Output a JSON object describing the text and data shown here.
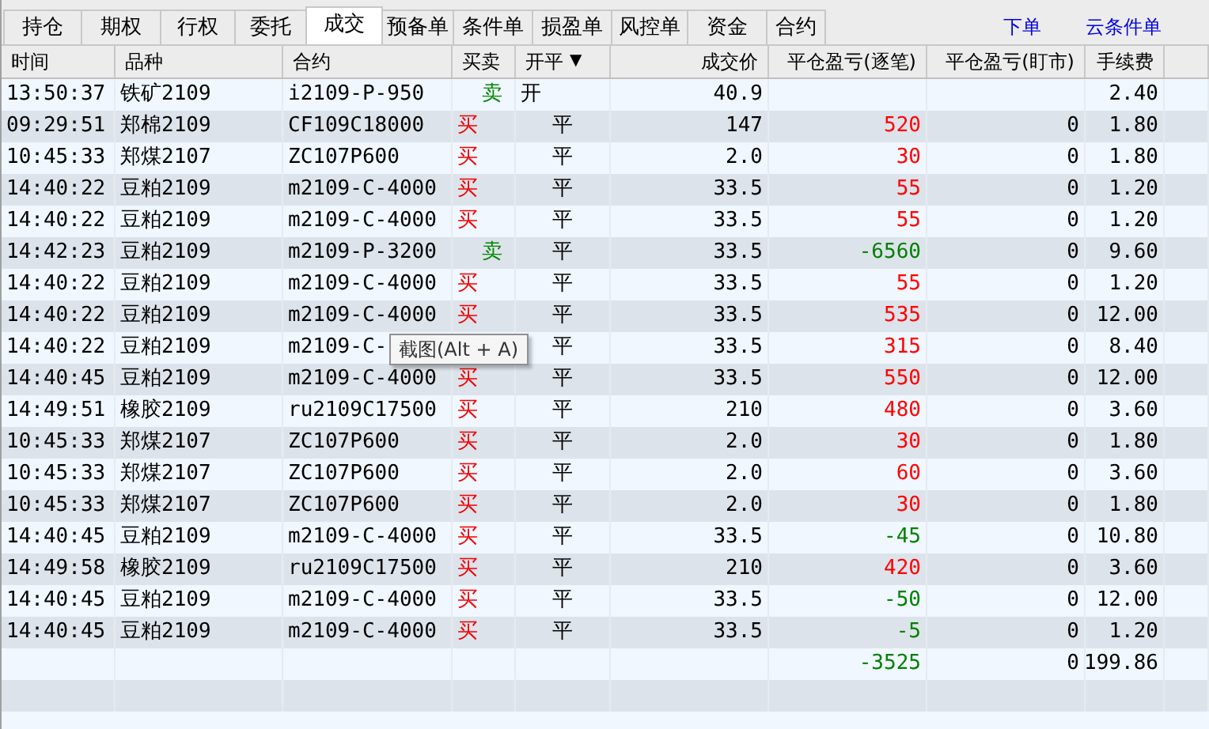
{
  "tabs": [
    {
      "label": "持仓",
      "selected": false
    },
    {
      "label": "期权",
      "selected": false
    },
    {
      "label": "行权",
      "selected": false
    },
    {
      "label": "委托",
      "selected": false
    },
    {
      "label": "成交",
      "selected": true
    },
    {
      "label": "预备单",
      "selected": false
    },
    {
      "label": "条件单",
      "selected": false
    },
    {
      "label": "损盈单",
      "selected": false
    },
    {
      "label": "风控单",
      "selected": false
    },
    {
      "label": "资金",
      "selected": false
    },
    {
      "label": "合约",
      "selected": false
    }
  ],
  "links": [
    "下单",
    "云条件单"
  ],
  "table": {
    "columns": [
      {
        "label": "时间"
      },
      {
        "label": "品种"
      },
      {
        "label": "合约"
      },
      {
        "label": "买卖"
      },
      {
        "label": "开平",
        "sort": "▼"
      },
      {
        "label": "成交价"
      },
      {
        "label": "平仓盈亏(逐笔)"
      },
      {
        "label": "平仓盈亏(盯市)"
      },
      {
        "label": "手续费"
      }
    ],
    "rows": [
      {
        "time": "13:50:37",
        "variety": "铁矿2109",
        "contract": "i2109-P-950",
        "side": {
          "text": "卖",
          "kind": "sell"
        },
        "offset": {
          "text": "开",
          "kind": "open"
        },
        "price": "40.9",
        "fee": "2.40"
      },
      {
        "time": "09:29:51",
        "variety": "郑棉2109",
        "contract": "CF109C18000",
        "side": {
          "text": "买",
          "kind": "buy"
        },
        "offset": {
          "text": "平",
          "kind": "close"
        },
        "price": "147",
        "pnl": {
          "text": "520",
          "color": "#ff0000"
        },
        "pnl_mark": "0",
        "fee": "1.80"
      },
      {
        "time": "10:45:33",
        "variety": "郑煤2107",
        "contract": "ZC107P600",
        "side": {
          "text": "买",
          "kind": "buy"
        },
        "offset": {
          "text": "平",
          "kind": "close"
        },
        "price": "2.0",
        "pnl": {
          "text": "30",
          "color": "#ff0000"
        },
        "pnl_mark": "0",
        "fee": "1.80"
      },
      {
        "time": "14:40:22",
        "variety": "豆粕2109",
        "contract": "m2109-C-4000",
        "side": {
          "text": "买",
          "kind": "buy"
        },
        "offset": {
          "text": "平",
          "kind": "close"
        },
        "price": "33.5",
        "pnl": {
          "text": "55",
          "color": "#ff0000"
        },
        "pnl_mark": "0",
        "fee": "1.20"
      },
      {
        "time": "14:40:22",
        "variety": "豆粕2109",
        "contract": "m2109-C-4000",
        "side": {
          "text": "买",
          "kind": "buy"
        },
        "offset": {
          "text": "平",
          "kind": "close"
        },
        "price": "33.5",
        "pnl": {
          "text": "55",
          "color": "#ff0000"
        },
        "pnl_mark": "0",
        "fee": "1.20"
      },
      {
        "time": "14:42:23",
        "variety": "豆粕2109",
        "contract": "m2109-P-3200",
        "side": {
          "text": "卖",
          "kind": "sell"
        },
        "offset": {
          "text": "平",
          "kind": "close"
        },
        "price": "33.5",
        "pnl": {
          "text": "-6560",
          "color": "#008000"
        },
        "pnl_mark": "0",
        "fee": "9.60"
      },
      {
        "time": "14:40:22",
        "variety": "豆粕2109",
        "contract": "m2109-C-4000",
        "side": {
          "text": "买",
          "kind": "buy"
        },
        "offset": {
          "text": "平",
          "kind": "close"
        },
        "price": "33.5",
        "pnl": {
          "text": "55",
          "color": "#ff0000"
        },
        "pnl_mark": "0",
        "fee": "1.20"
      },
      {
        "time": "14:40:22",
        "variety": "豆粕2109",
        "contract": "m2109-C-4000",
        "side": {
          "text": "买",
          "kind": "buy"
        },
        "offset": {
          "text": "平",
          "kind": "close"
        },
        "price": "33.5",
        "pnl": {
          "text": "535",
          "color": "#ff0000"
        },
        "pnl_mark": "0",
        "fee": "12.00"
      },
      {
        "time": "14:40:22",
        "variety": "豆粕2109",
        "contract": "m2109-C-",
        "offset": {
          "text": "平",
          "kind": "close"
        },
        "price": "33.5",
        "pnl": {
          "text": "315",
          "color": "#ff0000"
        },
        "pnl_mark": "0",
        "fee": "8.40"
      },
      {
        "time": "14:40:45",
        "variety": "豆粕2109",
        "contract": "m2109-C-4000",
        "side": {
          "text": "买",
          "kind": "buy"
        },
        "offset": {
          "text": "平",
          "kind": "close"
        },
        "price": "33.5",
        "pnl": {
          "text": "550",
          "color": "#ff0000"
        },
        "pnl_mark": "0",
        "fee": "12.00"
      },
      {
        "time": "14:49:51",
        "variety": "橡胶2109",
        "contract": "ru2109C17500",
        "side": {
          "text": "买",
          "kind": "buy"
        },
        "offset": {
          "text": "平",
          "kind": "close"
        },
        "price": "210",
        "pnl": {
          "text": "480",
          "color": "#ff0000"
        },
        "pnl_mark": "0",
        "fee": "3.60"
      },
      {
        "time": "10:45:33",
        "variety": "郑煤2107",
        "contract": "ZC107P600",
        "side": {
          "text": "买",
          "kind": "buy"
        },
        "offset": {
          "text": "平",
          "kind": "close"
        },
        "price": "2.0",
        "pnl": {
          "text": "30",
          "color": "#ff0000"
        },
        "pnl_mark": "0",
        "fee": "1.80"
      },
      {
        "time": "10:45:33",
        "variety": "郑煤2107",
        "contract": "ZC107P600",
        "side": {
          "text": "买",
          "kind": "buy"
        },
        "offset": {
          "text": "平",
          "kind": "close"
        },
        "price": "2.0",
        "pnl": {
          "text": "60",
          "color": "#ff0000"
        },
        "pnl_mark": "0",
        "fee": "3.60"
      },
      {
        "time": "10:45:33",
        "variety": "郑煤2107",
        "contract": "ZC107P600",
        "side": {
          "text": "买",
          "kind": "buy"
        },
        "offset": {
          "text": "平",
          "kind": "close"
        },
        "price": "2.0",
        "pnl": {
          "text": "30",
          "color": "#ff0000"
        },
        "pnl_mark": "0",
        "fee": "1.80"
      },
      {
        "time": "14:40:45",
        "variety": "豆粕2109",
        "contract": "m2109-C-4000",
        "side": {
          "text": "买",
          "kind": "buy"
        },
        "offset": {
          "text": "平",
          "kind": "close"
        },
        "price": "33.5",
        "pnl": {
          "text": "-45",
          "color": "#008000"
        },
        "pnl_mark": "0",
        "fee": "10.80"
      },
      {
        "time": "14:49:58",
        "variety": "橡胶2109",
        "contract": "ru2109C17500",
        "side": {
          "text": "买",
          "kind": "buy"
        },
        "offset": {
          "text": "平",
          "kind": "close"
        },
        "price": "210",
        "pnl": {
          "text": "420",
          "color": "#ff0000"
        },
        "pnl_mark": "0",
        "fee": "3.60"
      },
      {
        "time": "14:40:45",
        "variety": "豆粕2109",
        "contract": "m2109-C-4000",
        "side": {
          "text": "买",
          "kind": "buy"
        },
        "offset": {
          "text": "平",
          "kind": "close"
        },
        "price": "33.5",
        "pnl": {
          "text": "-50",
          "color": "#008000"
        },
        "pnl_mark": "0",
        "fee": "12.00"
      },
      {
        "time": "14:40:45",
        "variety": "豆粕2109",
        "contract": "m2109-C-4000",
        "side": {
          "text": "买",
          "kind": "buy"
        },
        "offset": {
          "text": "平",
          "kind": "close"
        },
        "price": "33.5",
        "pnl": {
          "text": "-5",
          "color": "#008000"
        },
        "pnl_mark": "0",
        "fee": "1.20"
      }
    ],
    "totals": {
      "pnl": {
        "text": "-3525",
        "color": "#008000"
      },
      "pnl_mark": "0",
      "fee": "199.86"
    }
  },
  "tooltip": "截图(Alt + A)"
}
